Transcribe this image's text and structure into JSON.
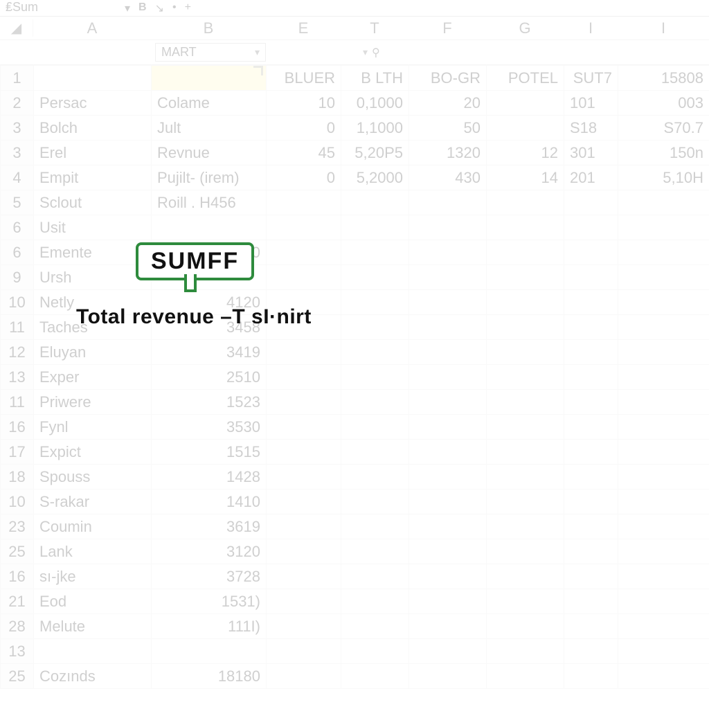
{
  "toolbar": {
    "title_fragment": "₤Sum"
  },
  "columns": [
    "A",
    "B",
    "E",
    "T",
    "F",
    "G",
    "I",
    "I"
  ],
  "name_box": "MART",
  "header_row": {
    "E": "BLUER",
    "T": "B LTH",
    "F": "BO-GR",
    "G": "POTEL",
    "Ic": "SUT7",
    "I": "15808"
  },
  "callout": {
    "badge": "SUMFF",
    "caption": "Total revenue –T sI·nirt"
  },
  "rows": [
    {
      "rn": "1",
      "A": "",
      "B": "",
      "E": "",
      "T": "",
      "F": "",
      "G": "",
      "Ic": "",
      "I": ""
    },
    {
      "rn": "2",
      "A": "Persac",
      "B": "Colame",
      "E": "10",
      "T": "0,1000",
      "F": "20",
      "G": "",
      "Ic": "101",
      "I": "003"
    },
    {
      "rn": "3",
      "A": "Bolch",
      "B": "Jult",
      "E": "0",
      "T": "1,1000",
      "F": "50",
      "G": "",
      "Ic": "S18",
      "I": "S70.7"
    },
    {
      "rn": "3",
      "A": "Erel",
      "B": "Revnue",
      "E": "45",
      "T": "5,20P5",
      "F": "1320",
      "G": "12",
      "Ic": "301",
      "I": "150n"
    },
    {
      "rn": "4",
      "A": "Empit",
      "B": "Pujilt- (irem)",
      "E": "0",
      "T": "5,2000",
      "F": "430",
      "G": "14",
      "Ic": "201",
      "I": "5,10H"
    },
    {
      "rn": "5",
      "A": "Sclout",
      "B": "Roill . H456",
      "E": "",
      "T": "",
      "F": "",
      "G": "",
      "Ic": "",
      "I": ""
    },
    {
      "rn": "6",
      "A": "Usit",
      "B": "",
      "E": "",
      "T": "",
      "F": "",
      "G": "",
      "Ic": "",
      "I": ""
    },
    {
      "rn": "6",
      "A": "Emente",
      "B": "01 10",
      "E": "",
      "T": "",
      "F": "",
      "G": "",
      "Ic": "",
      "I": ""
    },
    {
      "rn": "9",
      "A": "Ursh",
      "B": "",
      "E": "",
      "T": "",
      "F": "",
      "G": "",
      "Ic": "",
      "I": ""
    },
    {
      "rn": "10",
      "A": "Netly",
      "B": "4120",
      "E": "",
      "T": "",
      "F": "",
      "G": "",
      "Ic": "",
      "I": ""
    },
    {
      "rn": "11",
      "A": "Taches",
      "B": "3458",
      "E": "",
      "T": "",
      "F": "",
      "G": "",
      "Ic": "",
      "I": ""
    },
    {
      "rn": "12",
      "A": "Eluyan",
      "B": "3419",
      "E": "",
      "T": "",
      "F": "",
      "G": "",
      "Ic": "",
      "I": ""
    },
    {
      "rn": "13",
      "A": "Exper",
      "B": "2510",
      "E": "",
      "T": "",
      "F": "",
      "G": "",
      "Ic": "",
      "I": ""
    },
    {
      "rn": "11",
      "A": "Priwere",
      "B": "1523",
      "E": "",
      "T": "",
      "F": "",
      "G": "",
      "Ic": "",
      "I": ""
    },
    {
      "rn": "16",
      "A": "Fynl",
      "B": "3530",
      "E": "",
      "T": "",
      "F": "",
      "G": "",
      "Ic": "",
      "I": ""
    },
    {
      "rn": "17",
      "A": "Expict",
      "B": "1515",
      "E": "",
      "T": "",
      "F": "",
      "G": "",
      "Ic": "",
      "I": ""
    },
    {
      "rn": "18",
      "A": "Spouss",
      "B": "1428",
      "E": "",
      "T": "",
      "F": "",
      "G": "",
      "Ic": "",
      "I": ""
    },
    {
      "rn": "10",
      "A": "S-rakar",
      "B": "1410",
      "E": "",
      "T": "",
      "F": "",
      "G": "",
      "Ic": "",
      "I": ""
    },
    {
      "rn": "23",
      "A": "Coumin",
      "B": "3619",
      "E": "",
      "T": "",
      "F": "",
      "G": "",
      "Ic": "",
      "I": ""
    },
    {
      "rn": "25",
      "A": "Lank",
      "B": "3120",
      "E": "",
      "T": "",
      "F": "",
      "G": "",
      "Ic": "",
      "I": ""
    },
    {
      "rn": "16",
      "A": "sı-jke",
      "B": "3728",
      "E": "",
      "T": "",
      "F": "",
      "G": "",
      "Ic": "",
      "I": ""
    },
    {
      "rn": "21",
      "A": "Eod",
      "B": "1531)",
      "E": "",
      "T": "",
      "F": "",
      "G": "",
      "Ic": "",
      "I": ""
    },
    {
      "rn": "28",
      "A": "Melute",
      "B": "111I)",
      "E": "",
      "T": "",
      "F": "",
      "G": "",
      "Ic": "",
      "I": ""
    },
    {
      "rn": "13",
      "A": "",
      "B": "",
      "E": "",
      "T": "",
      "F": "",
      "G": "",
      "Ic": "",
      "I": ""
    },
    {
      "rn": "25",
      "A": "Cozınds",
      "B": "18180",
      "E": "",
      "T": "",
      "F": "",
      "G": "",
      "Ic": "",
      "I": ""
    }
  ]
}
